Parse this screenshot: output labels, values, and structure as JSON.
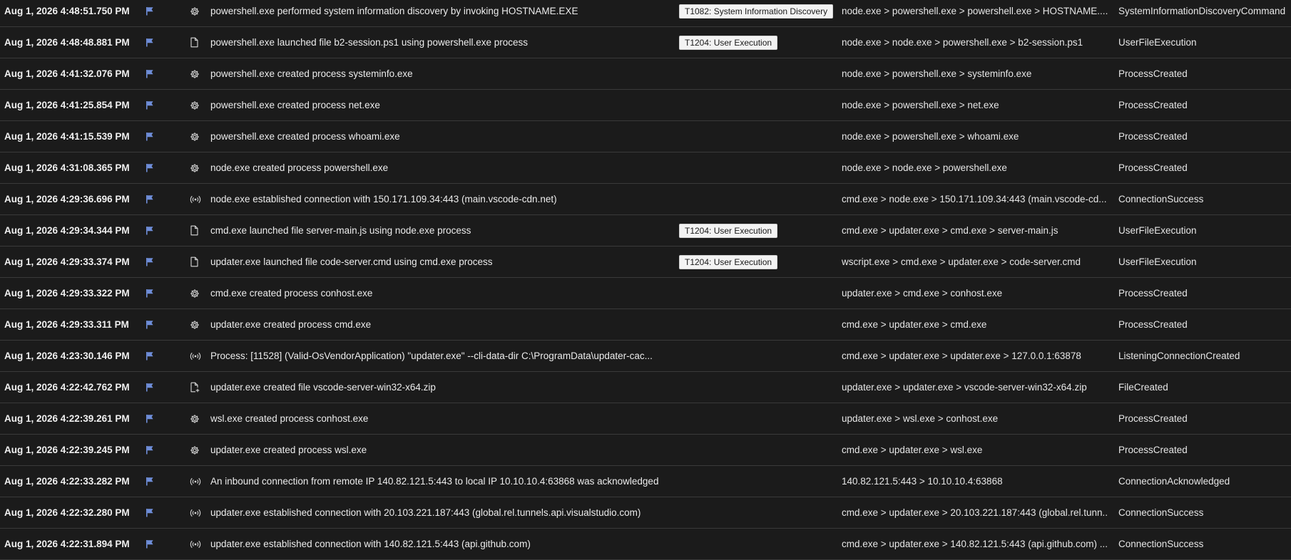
{
  "events": [
    {
      "timestamp": "Aug 1, 2026 4:48:51.750 PM",
      "icon": "gear-icon",
      "description": "powershell.exe performed system information discovery by invoking HOSTNAME.EXE",
      "technique": "T1082: System Information Discovery",
      "chain": "node.exe > powershell.exe > powershell.exe > HOSTNAME....",
      "action_type": "SystemInformationDiscoveryCommand"
    },
    {
      "timestamp": "Aug 1, 2026 4:48:48.881 PM",
      "icon": "file-icon",
      "description": "powershell.exe launched file b2-session.ps1 using powershell.exe process",
      "technique": "T1204: User Execution",
      "chain": "node.exe > node.exe > powershell.exe > b2-session.ps1",
      "action_type": "UserFileExecution"
    },
    {
      "timestamp": "Aug 1, 2026 4:41:32.076 PM",
      "icon": "gear-icon",
      "description": "powershell.exe created process systeminfo.exe",
      "technique": "",
      "chain": "node.exe > powershell.exe > systeminfo.exe",
      "action_type": "ProcessCreated"
    },
    {
      "timestamp": "Aug 1, 2026 4:41:25.854 PM",
      "icon": "gear-icon",
      "description": "powershell.exe created process net.exe",
      "technique": "",
      "chain": "node.exe > powershell.exe > net.exe",
      "action_type": "ProcessCreated"
    },
    {
      "timestamp": "Aug 1, 2026 4:41:15.539 PM",
      "icon": "gear-icon",
      "description": "powershell.exe created process whoami.exe",
      "technique": "",
      "chain": "node.exe > powershell.exe > whoami.exe",
      "action_type": "ProcessCreated"
    },
    {
      "timestamp": "Aug 1, 2026 4:31:08.365 PM",
      "icon": "gear-icon",
      "description": "node.exe created process powershell.exe",
      "technique": "",
      "chain": "node.exe > node.exe > powershell.exe",
      "action_type": "ProcessCreated"
    },
    {
      "timestamp": "Aug 1, 2026 4:29:36.696 PM",
      "icon": "network-icon",
      "description": "node.exe established connection with 150.171.109.34:443 (main.vscode-cdn.net)",
      "technique": "",
      "chain": "cmd.exe > node.exe > 150.171.109.34:443 (main.vscode-cd...",
      "action_type": "ConnectionSuccess"
    },
    {
      "timestamp": "Aug 1, 2026 4:29:34.344 PM",
      "icon": "file-icon",
      "description": "cmd.exe launched file server-main.js using node.exe process",
      "technique": "T1204: User Execution",
      "chain": "cmd.exe > updater.exe > cmd.exe > server-main.js",
      "action_type": "UserFileExecution"
    },
    {
      "timestamp": "Aug 1, 2026 4:29:33.374 PM",
      "icon": "file-icon",
      "description": "updater.exe launched file code-server.cmd using cmd.exe process",
      "technique": "T1204: User Execution",
      "chain": "wscript.exe > cmd.exe > updater.exe > code-server.cmd",
      "action_type": "UserFileExecution"
    },
    {
      "timestamp": "Aug 1, 2026 4:29:33.322 PM",
      "icon": "gear-icon",
      "description": "cmd.exe created process conhost.exe",
      "technique": "",
      "chain": "updater.exe > cmd.exe > conhost.exe",
      "action_type": "ProcessCreated"
    },
    {
      "timestamp": "Aug 1, 2026 4:29:33.311 PM",
      "icon": "gear-icon",
      "description": "updater.exe created process cmd.exe",
      "technique": "",
      "chain": "cmd.exe > updater.exe > cmd.exe",
      "action_type": "ProcessCreated"
    },
    {
      "timestamp": "Aug 1, 2026 4:23:30.146 PM",
      "icon": "network-icon",
      "description": "Process: [11528] (Valid-OsVendorApplication) \"updater.exe\" --cli-data-dir C:\\ProgramData\\updater-cac...",
      "technique": "",
      "chain": "cmd.exe > updater.exe > updater.exe > 127.0.0.1:63878",
      "action_type": "ListeningConnectionCreated"
    },
    {
      "timestamp": "Aug 1, 2026 4:22:42.762 PM",
      "icon": "file-add-icon",
      "description": "updater.exe created file vscode-server-win32-x64.zip",
      "technique": "",
      "chain": "updater.exe > updater.exe > vscode-server-win32-x64.zip",
      "action_type": "FileCreated"
    },
    {
      "timestamp": "Aug 1, 2026 4:22:39.261 PM",
      "icon": "gear-icon",
      "description": "wsl.exe created process conhost.exe",
      "technique": "",
      "chain": "updater.exe > wsl.exe > conhost.exe",
      "action_type": "ProcessCreated"
    },
    {
      "timestamp": "Aug 1, 2026 4:22:39.245 PM",
      "icon": "gear-icon",
      "description": "updater.exe created process wsl.exe",
      "technique": "",
      "chain": "cmd.exe > updater.exe > wsl.exe",
      "action_type": "ProcessCreated"
    },
    {
      "timestamp": "Aug 1, 2026 4:22:33.282 PM",
      "icon": "network-icon",
      "description": "An inbound connection from remote IP 140.82.121.5:443 to local IP 10.10.10.4:63868 was acknowledged",
      "technique": "",
      "chain": "140.82.121.5:443 > 10.10.10.4:63868",
      "action_type": "ConnectionAcknowledged"
    },
    {
      "timestamp": "Aug 1, 2026 4:22:32.280 PM",
      "icon": "network-icon",
      "description": "updater.exe established connection with 20.103.221.187:443 (global.rel.tunnels.api.visualstudio.com)",
      "technique": "",
      "chain": "cmd.exe > updater.exe > 20.103.221.187:443 (global.rel.tunn...",
      "action_type": "ConnectionSuccess"
    },
    {
      "timestamp": "Aug 1, 2026 4:22:31.894 PM",
      "icon": "network-icon",
      "description": "updater.exe established connection with 140.82.121.5:443 (api.github.com)",
      "technique": "",
      "chain": "cmd.exe > updater.exe > 140.82.121.5:443 (api.github.com) ...",
      "action_type": "ConnectionSuccess"
    }
  ],
  "colors": {
    "background": "#1b1b1b",
    "row_divider": "#3a3a3a",
    "flag_accent": "#6f8ed9",
    "badge_bg": "#f3f3f3"
  }
}
